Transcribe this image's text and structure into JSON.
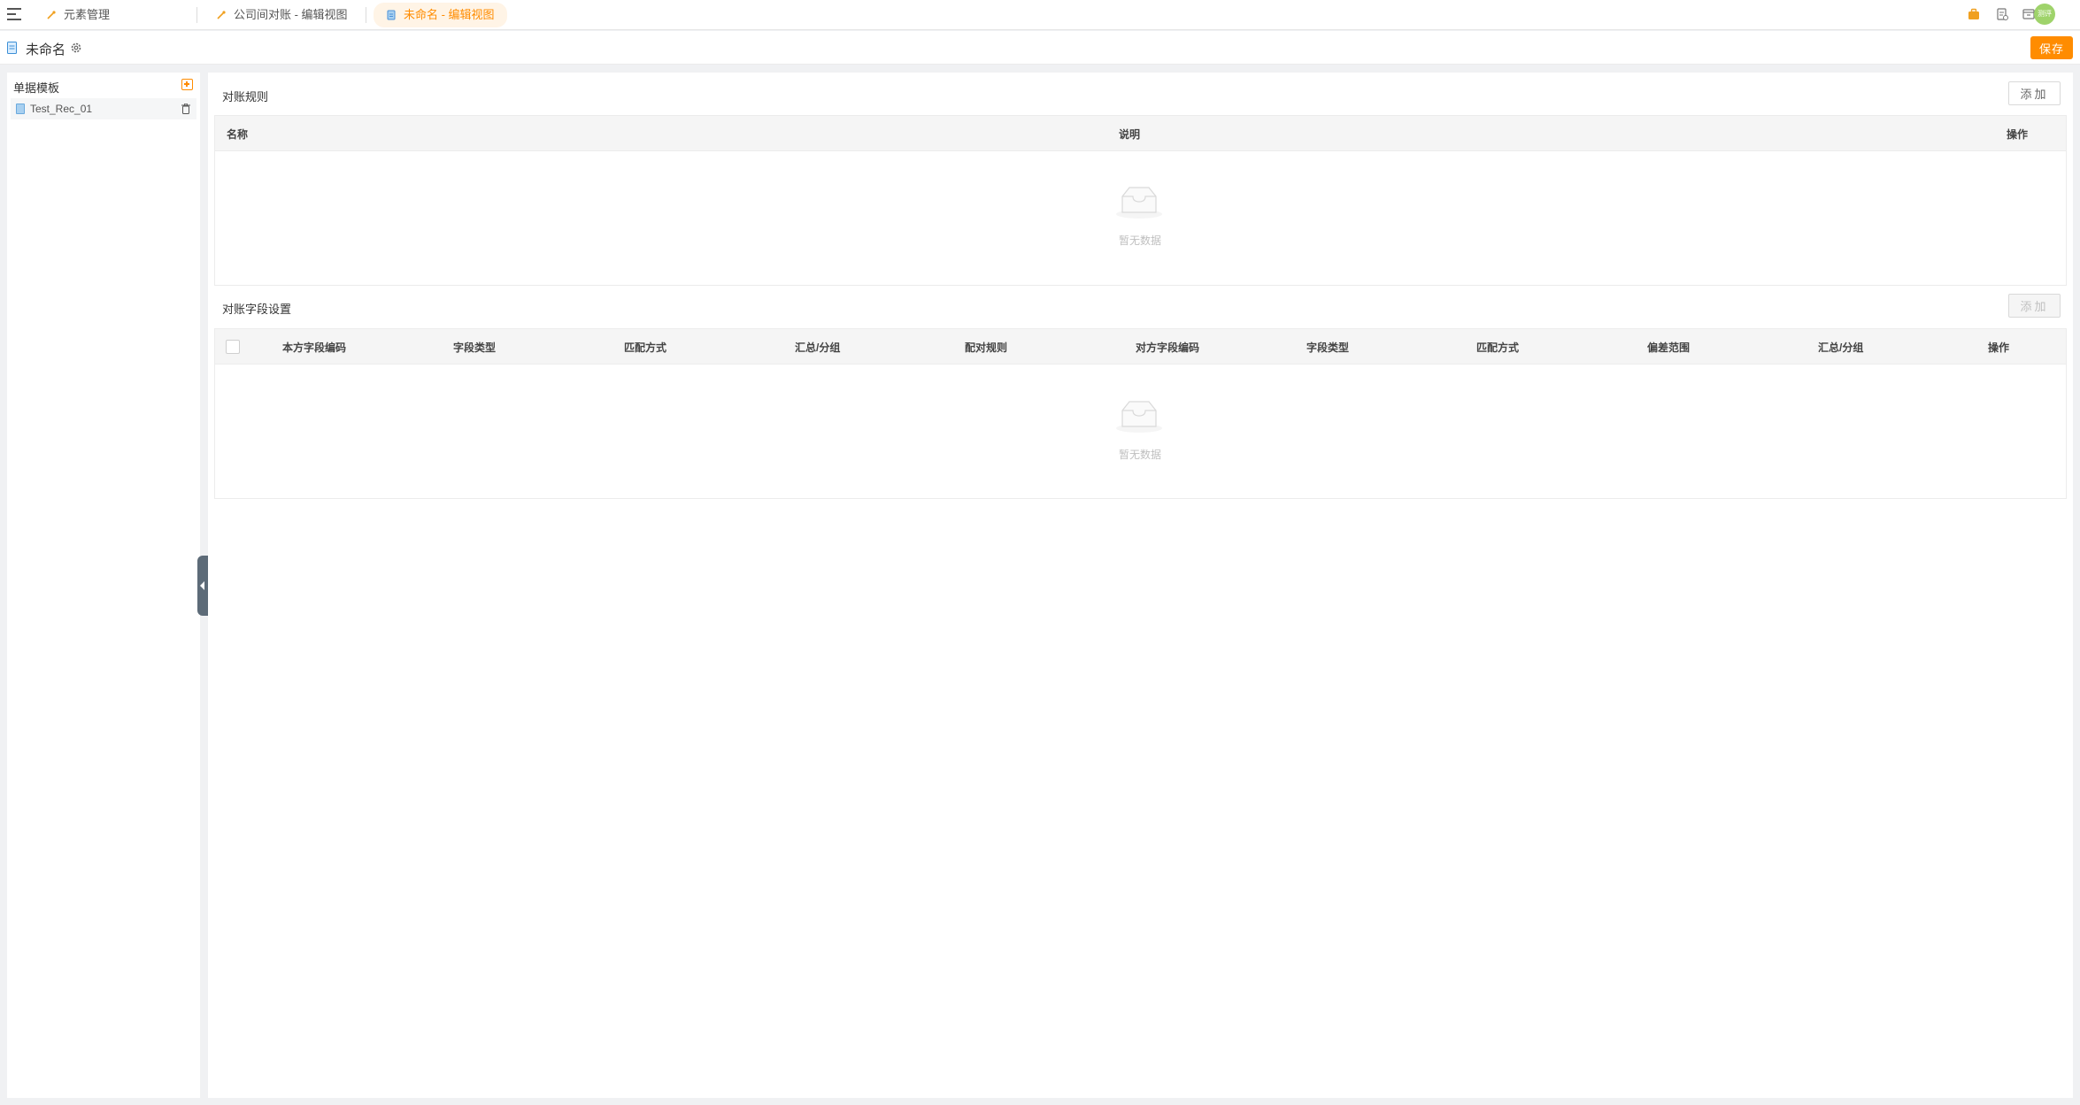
{
  "topbar": {
    "tabs": [
      {
        "label": "元素管理",
        "active": false
      },
      {
        "label": "公司间对账 - 编辑视图",
        "active": false
      },
      {
        "label": "未命名 - 编辑视图",
        "active": true
      }
    ],
    "avatar_text": "测评"
  },
  "header": {
    "title": "未命名",
    "save_label": "保存"
  },
  "sidebar": {
    "title": "单据模板",
    "items": [
      {
        "label": "Test_Rec_01"
      }
    ]
  },
  "rules": {
    "title": "对账规则",
    "add_label": "添加",
    "columns": [
      "名称",
      "说明",
      "操作"
    ],
    "empty_text": "暂无数据"
  },
  "fields": {
    "title": "对账字段设置",
    "add_label": "添加",
    "columns": [
      "本方字段编码",
      "字段类型",
      "匹配方式",
      "汇总/分组",
      "配对规则",
      "对方字段编码",
      "字段类型",
      "匹配方式",
      "偏差范围",
      "汇总/分组",
      "操作"
    ],
    "empty_text": "暂无数据"
  },
  "colors": {
    "accent": "#ff8c00",
    "avatar": "#9fd36b"
  }
}
